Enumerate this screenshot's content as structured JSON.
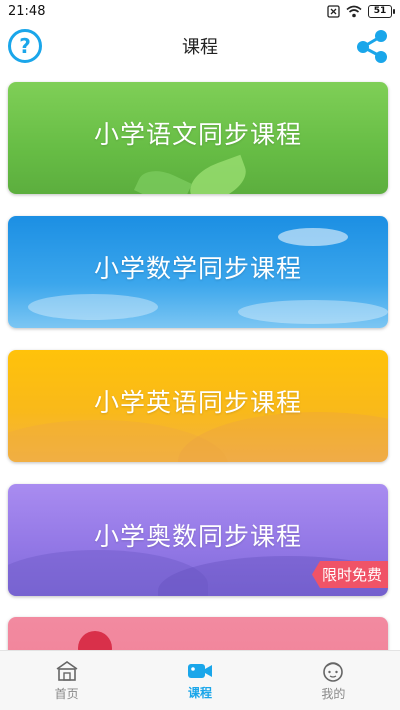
{
  "status_bar": {
    "time": "21:48",
    "battery": "51"
  },
  "header": {
    "title": "课程",
    "help_icon": "question-circle-icon",
    "share_icon": "share-icon"
  },
  "colors": {
    "accent": "#1aa6ea",
    "free_badge": "#f05367"
  },
  "courses": [
    {
      "title": "小学语文同步课程",
      "theme": "green-leaves"
    },
    {
      "title": "小学数学同步课程",
      "theme": "blue-sky"
    },
    {
      "title": "小学英语同步课程",
      "theme": "yellow-desert"
    },
    {
      "title": "小学奥数同步课程",
      "theme": "purple-mountains",
      "badge": "限时免费"
    },
    {
      "title": "",
      "theme": "pink"
    }
  ],
  "tabs": [
    {
      "label": "首页",
      "icon": "home-icon",
      "active": false
    },
    {
      "label": "课程",
      "icon": "video-camera-icon",
      "active": true
    },
    {
      "label": "我的",
      "icon": "face-icon",
      "active": false
    }
  ]
}
